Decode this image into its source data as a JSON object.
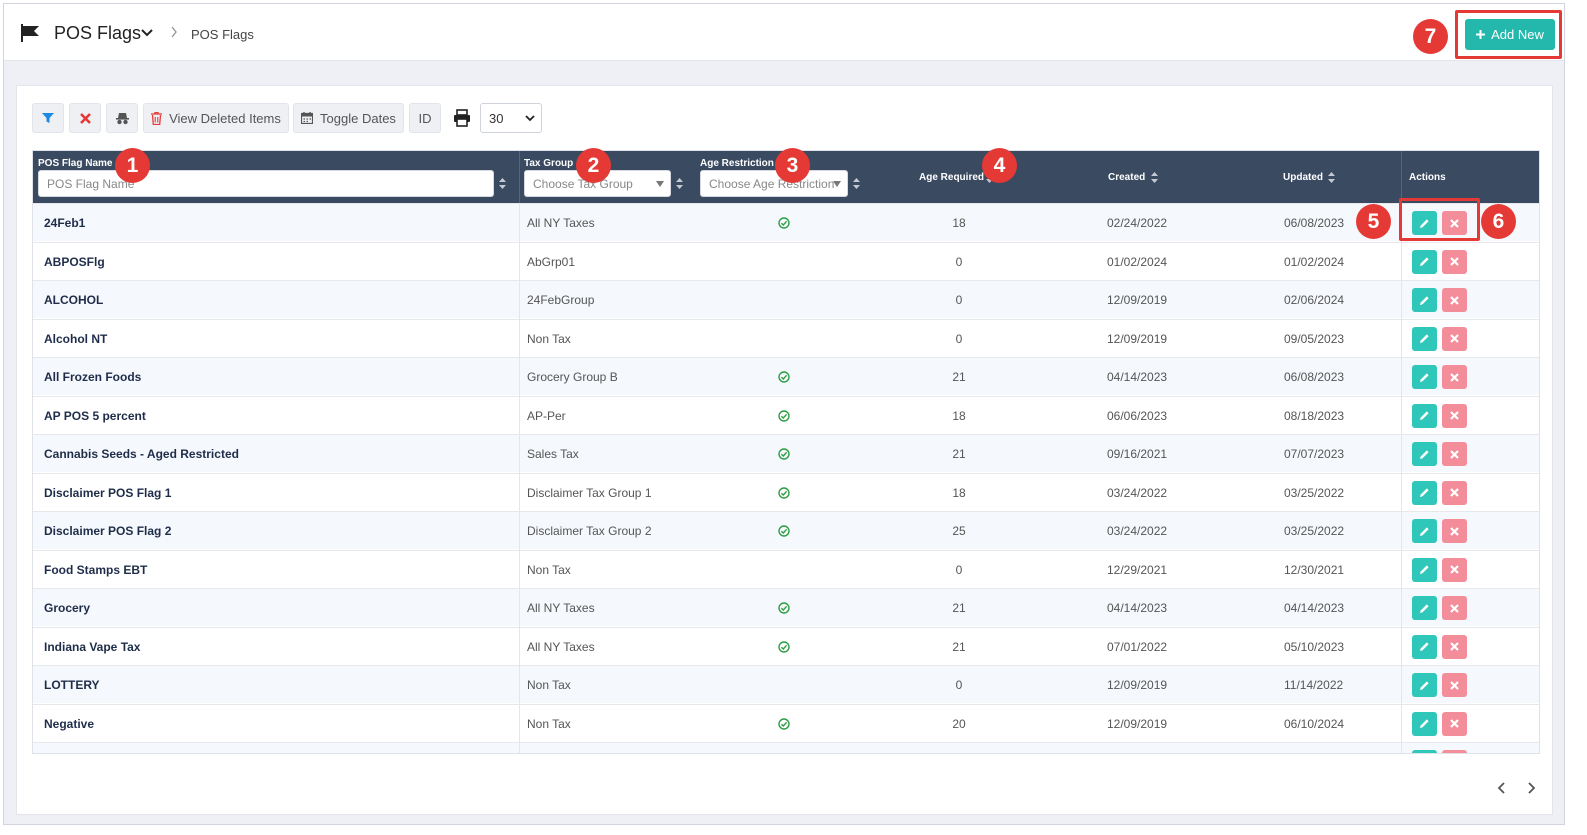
{
  "header": {
    "title": "POS Flags",
    "breadcrumb": "POS Flags",
    "add_new_label": "Add New"
  },
  "toolbar": {
    "view_deleted_label": "View Deleted Items",
    "toggle_dates_label": "Toggle Dates",
    "id_label": "ID",
    "page_size": "30"
  },
  "columns": {
    "name": "POS Flag Name",
    "tax_group": "Tax Group",
    "age_restriction": "Age Restriction",
    "age_required": "Age Required",
    "created": "Created",
    "updated": "Updated",
    "actions": "Actions"
  },
  "filters": {
    "name_placeholder": "POS Flag Name",
    "tax_group_placeholder": "Choose Tax Group",
    "age_restriction_placeholder": "Choose Age Restriction"
  },
  "rows": [
    {
      "name": "24Feb1",
      "tax_group": "All NY Taxes",
      "age_restricted": true,
      "age_required": "18",
      "created": "02/24/2022",
      "updated": "06/08/2023"
    },
    {
      "name": "ABPOSFlg",
      "tax_group": "AbGrp01",
      "age_restricted": false,
      "age_required": "0",
      "created": "01/02/2024",
      "updated": "01/02/2024"
    },
    {
      "name": "ALCOHOL",
      "tax_group": "24FebGroup",
      "age_restricted": false,
      "age_required": "0",
      "created": "12/09/2019",
      "updated": "02/06/2024"
    },
    {
      "name": "Alcohol NT",
      "tax_group": "Non Tax",
      "age_restricted": false,
      "age_required": "0",
      "created": "12/09/2019",
      "updated": "09/05/2023"
    },
    {
      "name": "All Frozen Foods",
      "tax_group": "Grocery Group B",
      "age_restricted": true,
      "age_required": "21",
      "created": "04/14/2023",
      "updated": "06/08/2023"
    },
    {
      "name": "AP POS 5 percent",
      "tax_group": "AP-Per",
      "age_restricted": true,
      "age_required": "18",
      "created": "06/06/2023",
      "updated": "08/18/2023"
    },
    {
      "name": "Cannabis Seeds - Aged Restricted",
      "tax_group": "Sales Tax",
      "age_restricted": true,
      "age_required": "21",
      "created": "09/16/2021",
      "updated": "07/07/2023"
    },
    {
      "name": "Disclaimer POS Flag 1",
      "tax_group": "Disclaimer Tax Group 1",
      "age_restricted": true,
      "age_required": "18",
      "created": "03/24/2022",
      "updated": "03/25/2022"
    },
    {
      "name": "Disclaimer POS Flag 2",
      "tax_group": "Disclaimer Tax Group 2",
      "age_restricted": true,
      "age_required": "25",
      "created": "03/24/2022",
      "updated": "03/25/2022"
    },
    {
      "name": "Food Stamps EBT",
      "tax_group": "Non Tax",
      "age_restricted": false,
      "age_required": "0",
      "created": "12/29/2021",
      "updated": "12/30/2021"
    },
    {
      "name": "Grocery",
      "tax_group": "All NY Taxes",
      "age_restricted": true,
      "age_required": "21",
      "created": "04/14/2023",
      "updated": "04/14/2023"
    },
    {
      "name": "Indiana Vape Tax",
      "tax_group": "All NY Taxes",
      "age_restricted": true,
      "age_required": "21",
      "created": "07/01/2022",
      "updated": "05/10/2023"
    },
    {
      "name": "LOTTERY",
      "tax_group": "Non Tax",
      "age_restricted": false,
      "age_required": "0",
      "created": "12/09/2019",
      "updated": "11/14/2022"
    },
    {
      "name": "Negative",
      "tax_group": "Non Tax",
      "age_restricted": true,
      "age_required": "20",
      "created": "12/09/2019",
      "updated": "06/10/2024"
    }
  ],
  "callouts": [
    "1",
    "2",
    "3",
    "4",
    "5",
    "6",
    "7"
  ],
  "colors": {
    "accent": "#24b8ad",
    "header_bg": "#3a4a61",
    "callout": "#e53935",
    "delete": "#f28d99",
    "check": "#2e9e44"
  },
  "icons": [
    "flag-icon",
    "chevron-down-icon",
    "filter-icon",
    "clear-filter-icon",
    "incognito-icon",
    "trash-icon",
    "calendar-icon",
    "print-icon",
    "check-circle-icon",
    "pencil-icon",
    "close-icon",
    "plus-icon"
  ]
}
